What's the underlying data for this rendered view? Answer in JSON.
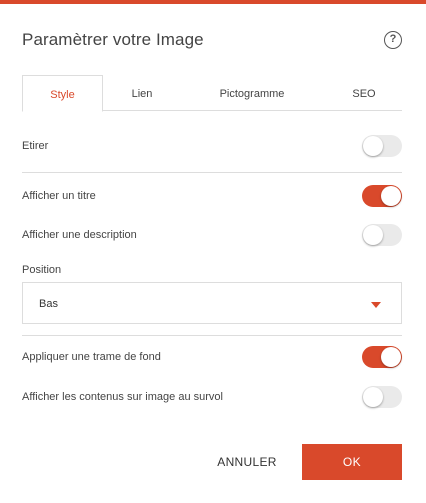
{
  "dialog": {
    "title": "Paramètrer votre Image",
    "help_icon": "question-circle-icon",
    "help_glyph": "?"
  },
  "tabs": [
    {
      "label": "Style",
      "active": true
    },
    {
      "label": "Lien",
      "active": false
    },
    {
      "label": "Pictogramme",
      "active": false
    },
    {
      "label": "SEO",
      "active": false
    }
  ],
  "settings": {
    "etirer": {
      "label": "Etirer",
      "enabled": false
    },
    "afficher_titre": {
      "label": "Afficher un titre",
      "enabled": true
    },
    "afficher_description": {
      "label": "Afficher une description",
      "enabled": false
    },
    "position": {
      "label": "Position",
      "value": "Bas"
    },
    "trame_fond": {
      "label": "Appliquer une trame de fond",
      "enabled": true
    },
    "contenus_survol": {
      "label": "Afficher les contenus sur image au survol",
      "enabled": false
    }
  },
  "actions": {
    "cancel_label": "ANNULER",
    "ok_label": "OK"
  },
  "colors": {
    "accent": "#d9492b",
    "toggle_off": "#eaeaea",
    "border": "#dddddd"
  }
}
